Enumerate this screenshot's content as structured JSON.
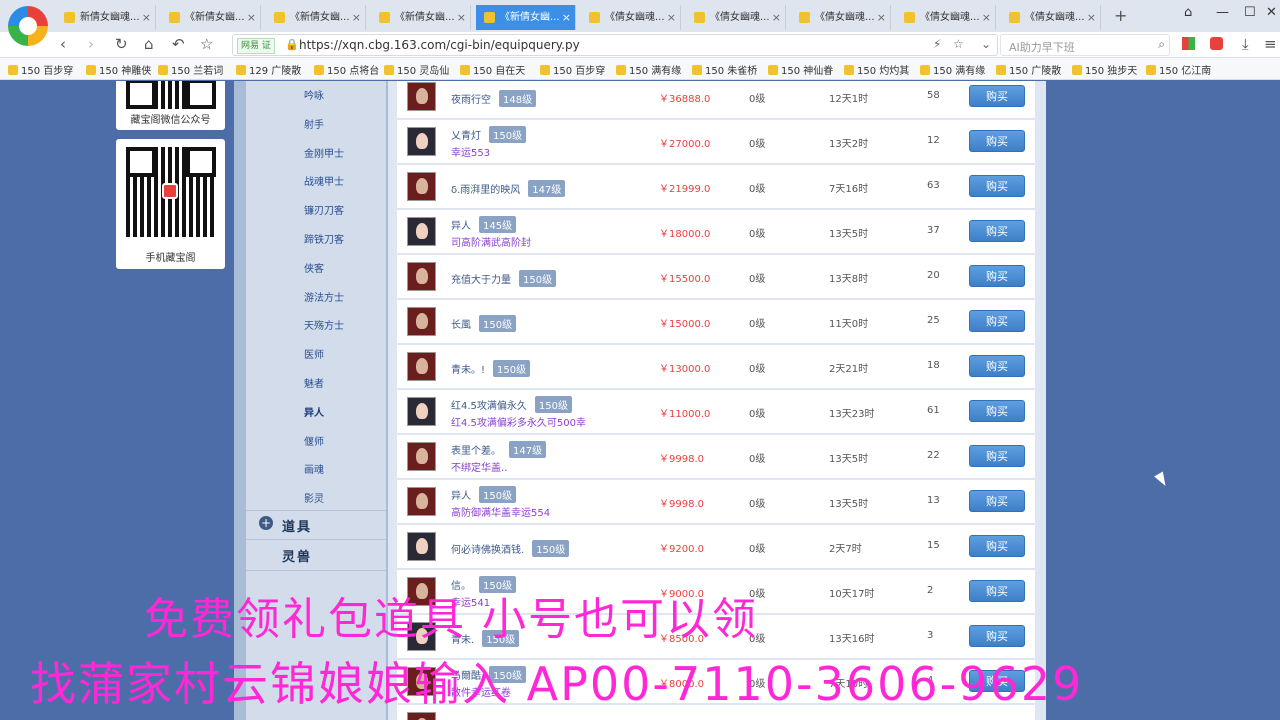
{
  "browser": {
    "tabs": [
      {
        "label": "新倩女幽魂...",
        "active": false
      },
      {
        "label": "《新倩女幽...",
        "active": false
      },
      {
        "label": "《新倩女幽...",
        "active": false
      },
      {
        "label": "《新倩女幽...",
        "active": false
      },
      {
        "label": "《新倩女幽...",
        "active": true
      },
      {
        "label": "《倩女幽魂...",
        "active": false
      },
      {
        "label": "《倩女幽魂...",
        "active": false
      },
      {
        "label": "《倩女幽魂...",
        "active": false
      },
      {
        "label": "《倩女幽魂...",
        "active": false
      },
      {
        "label": "《倩女幽魂...",
        "active": false
      }
    ],
    "url_badge": "网易 证",
    "url": "https://xqn.cbg.163.com/cgi-bin/equipquery.py",
    "ai_placeholder": "AI助力早下班",
    "bookmarks": [
      "150 百步穿",
      "150 神雕侠",
      "150 兰若词",
      "129 广陵散",
      "150 点将台",
      "150 灵岛仙",
      "150 自在天",
      "150 百步穿",
      "150 满有缘",
      "150 朱雀桥",
      "150 神仙眷",
      "150 灼灼其",
      "150 满有缘",
      "150 广陵散",
      "150 独步天",
      "150 亿江南"
    ]
  },
  "qr": {
    "wechat_label": "藏宝阁微信公众号",
    "mobile_label": "手机藏宝阁"
  },
  "sidebar": {
    "items": [
      "吟咏",
      "射手",
      "金刚甲士",
      "战魂甲士",
      "镰刃刀客",
      "蹄铁刀客",
      "侠客",
      "游法方士",
      "天殇方士",
      "医师",
      "魅者",
      "异人",
      "偃师",
      "画魂",
      "影灵"
    ],
    "active": "异人",
    "categories": [
      "道具",
      "灵兽"
    ]
  },
  "listings": [
    {
      "avatar": "m",
      "name": "夜雨行空",
      "level": "148级",
      "sub": "",
      "price": "￥36888.0",
      "grade": "0级",
      "time": "12天1时",
      "count": "58",
      "buy": "购买"
    },
    {
      "avatar": "f",
      "name": "乂青灯",
      "level": "150级",
      "sub": "幸运553",
      "price": "￥27000.0",
      "grade": "0级",
      "time": "13天2时",
      "count": "12",
      "buy": "购买"
    },
    {
      "avatar": "m",
      "name": "δ.雨湃里的映风",
      "level": "147级",
      "sub": "",
      "price": "￥21999.0",
      "grade": "0级",
      "time": "7天16时",
      "count": "63",
      "buy": "购买"
    },
    {
      "avatar": "f",
      "name": "异人",
      "level": "145级",
      "sub": "司高阶满武高阶封",
      "price": "￥18000.0",
      "grade": "0级",
      "time": "13天5时",
      "count": "37",
      "buy": "购买"
    },
    {
      "avatar": "m",
      "name": "充值大于力量",
      "level": "150级",
      "sub": "",
      "price": "￥15500.0",
      "grade": "0级",
      "time": "13天8时",
      "count": "20",
      "buy": "购买"
    },
    {
      "avatar": "m",
      "name": "长風",
      "level": "150级",
      "sub": "",
      "price": "￥15000.0",
      "grade": "0级",
      "time": "11天0时",
      "count": "25",
      "buy": "购买"
    },
    {
      "avatar": "m",
      "name": "青未。!",
      "level": "150级",
      "sub": "",
      "price": "￥13000.0",
      "grade": "0级",
      "time": "2天21时",
      "count": "18",
      "buy": "购买"
    },
    {
      "avatar": "f",
      "name": "红4.5攻满偏永久",
      "level": "150级",
      "sub": "红4.5攻满偏彩多永久可500幸",
      "price": "￥11000.0",
      "grade": "0级",
      "time": "13天23时",
      "count": "61",
      "buy": "购买"
    },
    {
      "avatar": "m",
      "name": "表里个差。",
      "level": "147级",
      "sub": "不绑定华盖..",
      "price": "￥9998.0",
      "grade": "0级",
      "time": "13天5时",
      "count": "22",
      "buy": "购买"
    },
    {
      "avatar": "m",
      "name": "异人",
      "level": "150级",
      "sub": "高防御满华盖幸运554",
      "price": "￥9998.0",
      "grade": "0级",
      "time": "13天5时",
      "count": "13",
      "buy": "购买"
    },
    {
      "avatar": "f",
      "name": "何必诗佛换酒钱.",
      "level": "150级",
      "sub": "",
      "price": "￥9200.0",
      "grade": "0级",
      "time": "2天7时",
      "count": "15",
      "buy": "购买"
    },
    {
      "avatar": "m",
      "name": "信。",
      "level": "150级",
      "sub": "幸运541",
      "price": "￥9000.0",
      "grade": "0级",
      "time": "10天17时",
      "count": "2",
      "buy": "购买"
    },
    {
      "avatar": "f",
      "name": "青未.",
      "level": "150级",
      "sub": "",
      "price": "￥8500.0",
      "grade": "0级",
      "time": "13天16时",
      "count": "3",
      "buy": "购买"
    },
    {
      "avatar": "m",
      "name": "马爾酷",
      "level": "150级",
      "sub": "散件幸运红卷",
      "price": "￥8000.0",
      "grade": "0级",
      "time": "7天10时",
      "count": "4",
      "buy": "购买"
    },
    {
      "avatar": "m",
      "name": "清香。",
      "level": "150级",
      "sub": "",
      "price": "",
      "grade": "",
      "time": "",
      "count": "",
      "buy": ""
    }
  ],
  "overlay": {
    "line1": "免费领礼包道具 小号也可以领",
    "line2": "找蒲家村云锦娘娘输入 AP00-7110-3606-9629"
  },
  "colors": {
    "accent": "#3b8fe6",
    "price": "#e8403c",
    "overlay": "#ff27d6",
    "page_bg": "#4d6da8"
  }
}
